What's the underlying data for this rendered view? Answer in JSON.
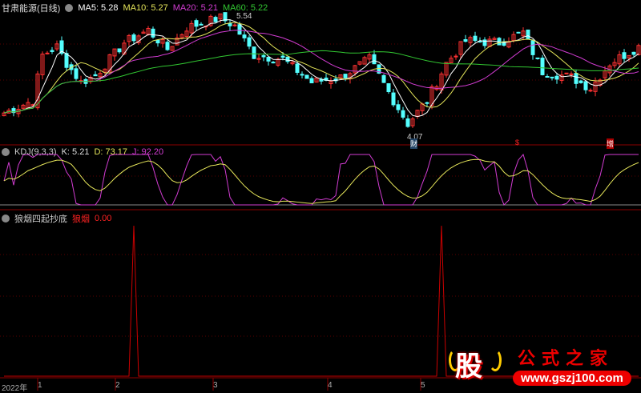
{
  "main": {
    "title": "甘肃能源(日线)",
    "ma5": "MA5: 5.28",
    "ma10": "MA10: 5.27",
    "ma20": "MA20: 5.21",
    "ma60": "MA60: 5.22",
    "high_label": "5.54",
    "low_label": "4.07",
    "markers": [
      "财",
      "$",
      "增"
    ]
  },
  "kdj": {
    "title": "KDJ(9,3,3)",
    "k": "K: 5.21",
    "d": "D: 73.17",
    "j": "J: 92.20"
  },
  "ind": {
    "title": "狼烟四起抄底",
    "name": "狼烟",
    "value": "0.00"
  },
  "xaxis": [
    "2022年",
    "1",
    "2",
    "3",
    "4",
    "5"
  ],
  "logo": {
    "char": "股",
    "site": "公式之家",
    "url": "www.gszj100.com"
  },
  "colors": {
    "up": "#ff3232",
    "down": "#54ffff",
    "ma5": "#ffffff",
    "ma10": "#e5e55a",
    "ma20": "#d23cd2",
    "ma60": "#32c832",
    "grid": "#8b0000"
  },
  "chart_data": {
    "type": "candlestick",
    "price_range": [
      4.07,
      5.54
    ],
    "close_keypoints": [
      [
        0,
        4.35
      ],
      [
        6,
        4.5
      ],
      [
        8,
        5.05
      ],
      [
        11,
        5.15
      ],
      [
        13,
        4.95
      ],
      [
        16,
        4.72
      ],
      [
        19,
        4.8
      ],
      [
        25,
        5.2
      ],
      [
        30,
        5.35
      ],
      [
        34,
        5.12
      ],
      [
        38,
        5.38
      ],
      [
        45,
        5.5
      ],
      [
        48,
        5.4
      ],
      [
        52,
        5.05
      ],
      [
        58,
        5.0
      ],
      [
        64,
        4.72
      ],
      [
        70,
        4.78
      ],
      [
        76,
        5.0
      ],
      [
        80,
        4.6
      ],
      [
        84,
        4.22
      ],
      [
        88,
        4.5
      ],
      [
        92,
        4.95
      ],
      [
        96,
        5.22
      ],
      [
        103,
        5.2
      ],
      [
        108,
        5.32
      ],
      [
        112,
        4.85
      ],
      [
        118,
        4.78
      ],
      [
        122,
        4.65
      ],
      [
        126,
        4.95
      ],
      [
        132,
        5.15
      ]
    ],
    "spikes": [
      27,
      91
    ]
  }
}
